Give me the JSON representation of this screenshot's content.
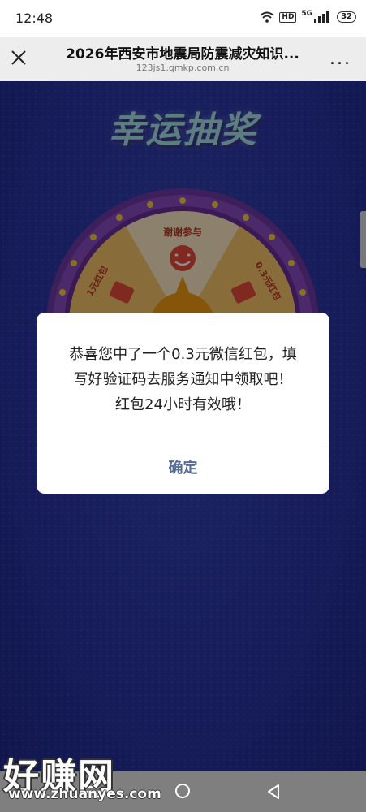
{
  "status_bar": {
    "time": "12:48",
    "hd_badge": "HD",
    "network": "5G",
    "battery": "32"
  },
  "title_bar": {
    "title": "2026年西安市地震局防震减灾知识...",
    "url": "123js1.qmkp.com.cn",
    "more_glyph": "..."
  },
  "wheel": {
    "heading": "幸运抽奖",
    "segments": [
      "谢谢参与",
      "0.3元红包",
      "1元红包"
    ],
    "colors": {
      "rim": "#7b3fb0",
      "bulb": "#f4d03f",
      "segment_light": "#fdebc7",
      "segment_dark": "#f7c56b"
    }
  },
  "dialog": {
    "message_lines": [
      "恭喜您中了一个0.3元微信红包，填",
      "写好验证码去服务通知中领取吧！",
      "红包24小时有效哦！"
    ],
    "confirm_label": "确定",
    "confirm_color": "#576b95"
  },
  "watermark": {
    "logo": "好赚网",
    "url": "www.zhuanyes.com"
  }
}
